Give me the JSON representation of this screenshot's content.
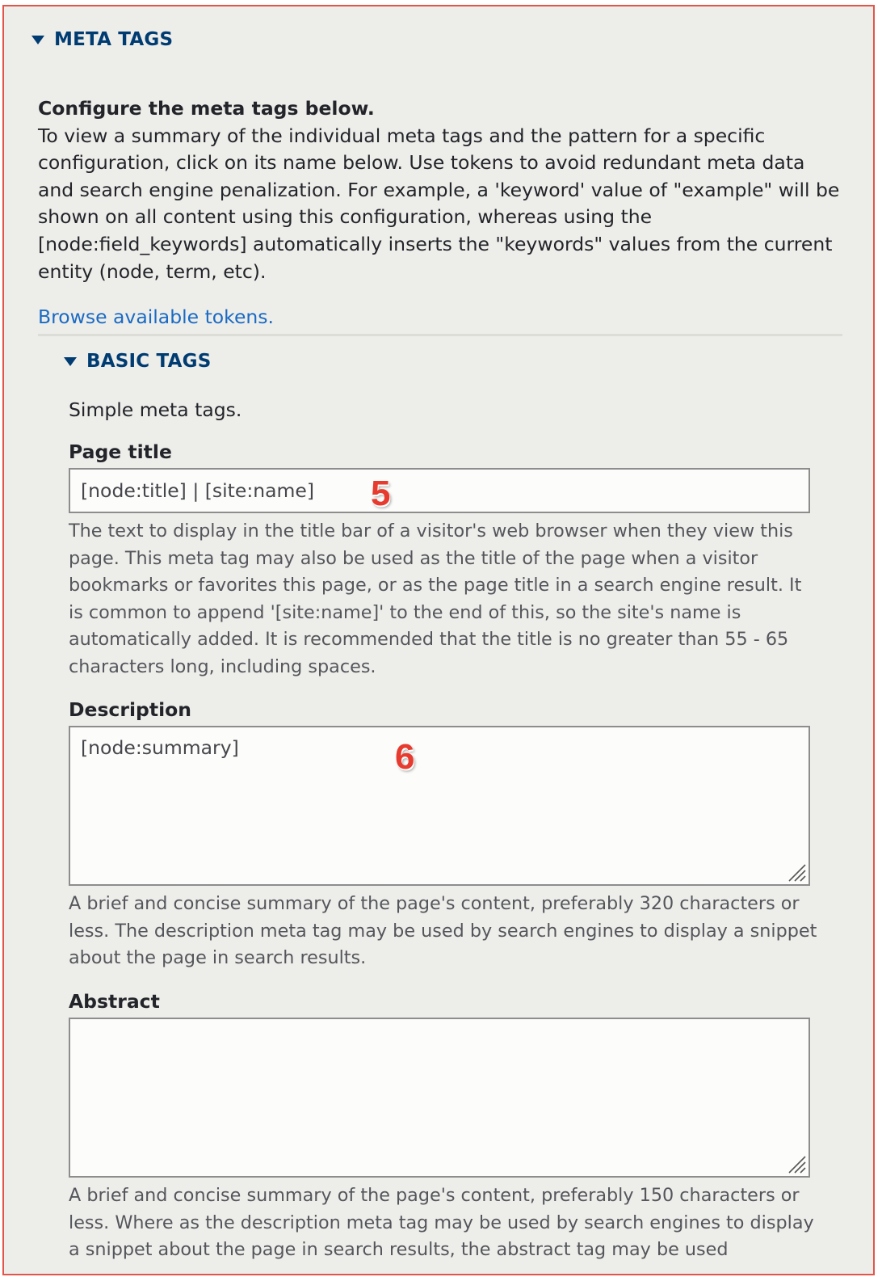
{
  "meta_tags": {
    "summary_label": "META TAGS",
    "intro_heading": "Configure the meta tags below.",
    "intro_text": "To view a summary of the individual meta tags and the pattern for a specific configuration, click on its name below. Use tokens to avoid redundant meta data and search engine penalization. For example, a 'keyword' value of \"example\" will be shown on all content using this configuration, whereas using the [node:field_keywords] automatically inserts the \"keywords\" values from the current entity (node, term, etc).",
    "tokens_link": "Browse available tokens."
  },
  "basic_tags": {
    "summary_label": "BASIC TAGS",
    "description": "Simple meta tags.",
    "fields": {
      "page_title": {
        "label": "Page title",
        "value": "[node:title] | [site:name]",
        "help": "The text to display in the title bar of a visitor's web browser when they view this page. This meta tag may also be used as the title of the page when a visitor bookmarks or favorites this page, or as the page title in a search engine result. It is common to append '[site:name]' to the end of this, so the site's name is automatically added. It is recommended that the title is no greater than 55 - 65 characters long, including spaces."
      },
      "description": {
        "label": "Description",
        "value": "[node:summary]",
        "help": "A brief and concise summary of the page's content, preferably 320 characters or less. The description meta tag may be used by search engines to display a snippet about the page in search results."
      },
      "abstract": {
        "label": "Abstract",
        "value": "",
        "help": "A brief and concise summary of the page's content, preferably 150 characters or less. Where as the description meta tag may be used by search engines to display a snippet about the page in search results, the abstract tag may be used"
      }
    }
  },
  "markers": {
    "page_title": "5",
    "description": "6"
  },
  "colors": {
    "accent": "#003c72",
    "link": "#1b6ac3",
    "marker": "#e63b2e",
    "frame": "#e2554a"
  }
}
